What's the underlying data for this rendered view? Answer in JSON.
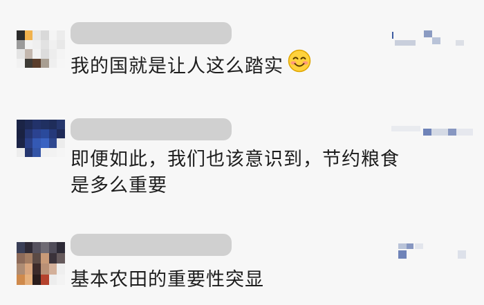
{
  "comments": [
    {
      "author": "",
      "text": "我的国就是让人这么踏实",
      "emoji": "smiling-face-icon"
    },
    {
      "author": "",
      "text_line1": "即便如此，我们也该意识到，节约粮食",
      "text_line2": "是多么重要"
    },
    {
      "author": "",
      "text": "基本农田的重要性突显"
    }
  ],
  "colors": {
    "background": "#f7f7f7",
    "name_redaction": "#d0d0d0",
    "text": "#1d1d1d"
  }
}
